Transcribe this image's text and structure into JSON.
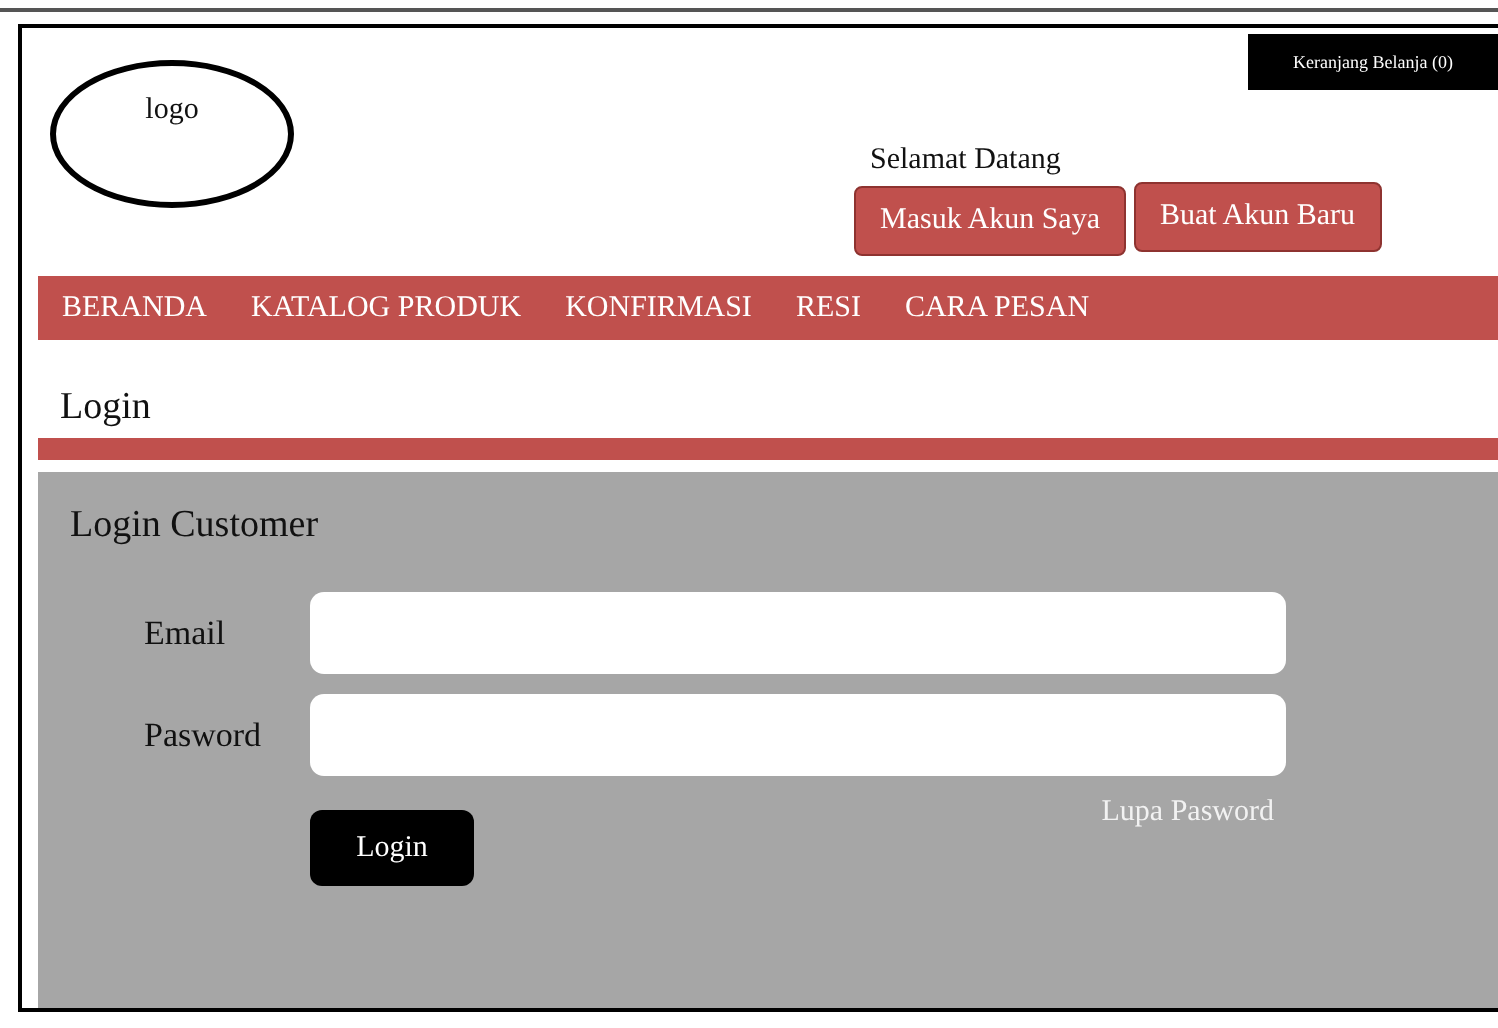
{
  "header": {
    "logo": "logo",
    "cart": "Keranjang Belanja (0)",
    "greeting": "Selamat Datang",
    "buttons": [
      "Masuk Akun Saya",
      "Buat Akun Baru"
    ]
  },
  "nav": [
    "BERANDA",
    "KATALOG PRODUK",
    "KONFIRMASI",
    "RESI",
    "CARA PESAN"
  ],
  "page_title": "Login",
  "form": {
    "title": "Login Customer",
    "fields": [
      {
        "label": "Email"
      },
      {
        "label": "Pasword"
      }
    ],
    "submit": "Login",
    "forgot_link": "Lupa Pasword"
  }
}
